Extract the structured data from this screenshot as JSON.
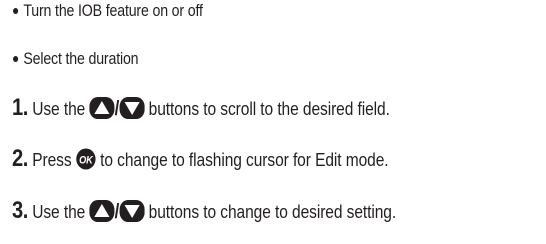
{
  "bullets": [
    {
      "text": "Turn the IOB feature on or off"
    },
    {
      "text": "Select the duration"
    }
  ],
  "steps": [
    {
      "number": "1.",
      "text_before": "Use the",
      "slash": "/",
      "text_after": "buttons to scroll to the desired field.",
      "icons": [
        "up-arrow-button-icon",
        "down-arrow-button-icon"
      ]
    },
    {
      "number": "2.",
      "text_before": "Press",
      "ok_label": "OK",
      "text_after": "to change to flashing cursor for Edit mode.",
      "icons": [
        "ok-button-icon"
      ]
    },
    {
      "number": "3.",
      "text_before": "Use the",
      "slash": "/",
      "text_after": "buttons to change to desired setting.",
      "icons": [
        "up-arrow-button-icon",
        "down-arrow-button-icon"
      ]
    }
  ],
  "colors": {
    "text": "#231f20",
    "icon_fill": "#231f20"
  }
}
